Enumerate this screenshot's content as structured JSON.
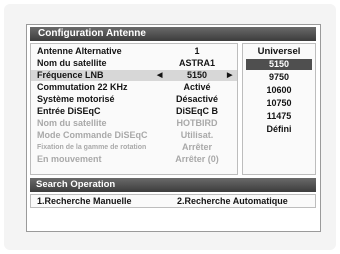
{
  "menu": {
    "title": "Configuration Antenne",
    "rows": [
      {
        "label": "Antenne Alternative",
        "value": "1"
      },
      {
        "label": "Nom du satellite",
        "value": "ASTRA1"
      },
      {
        "label": "Fréquence LNB",
        "value": "5150"
      },
      {
        "label": "Commutation 22 KHz",
        "value": "Activé"
      },
      {
        "label": "Système motorisé",
        "value": "Désactivé"
      },
      {
        "label": "Entrée DiSEqC",
        "value": "DiSEqC B"
      },
      {
        "label": "Nom du satellite",
        "value": "HOTBIRD"
      },
      {
        "label": "Mode Commande DiSEqC",
        "value": "Utilisat."
      },
      {
        "label": "Fixation de la gamme de rotation",
        "value": "Arrêter"
      },
      {
        "label": "En mouvement",
        "value": "Arrêter (0)"
      }
    ]
  },
  "freq_list": {
    "header": "Universel",
    "items": [
      "5150",
      "9750",
      "10600",
      "10750",
      "11475",
      "Défini"
    ]
  },
  "search": {
    "title": "Search Operation",
    "option1": "1.Recherche Manuelle",
    "option2": "2.Recherche Automatique"
  }
}
